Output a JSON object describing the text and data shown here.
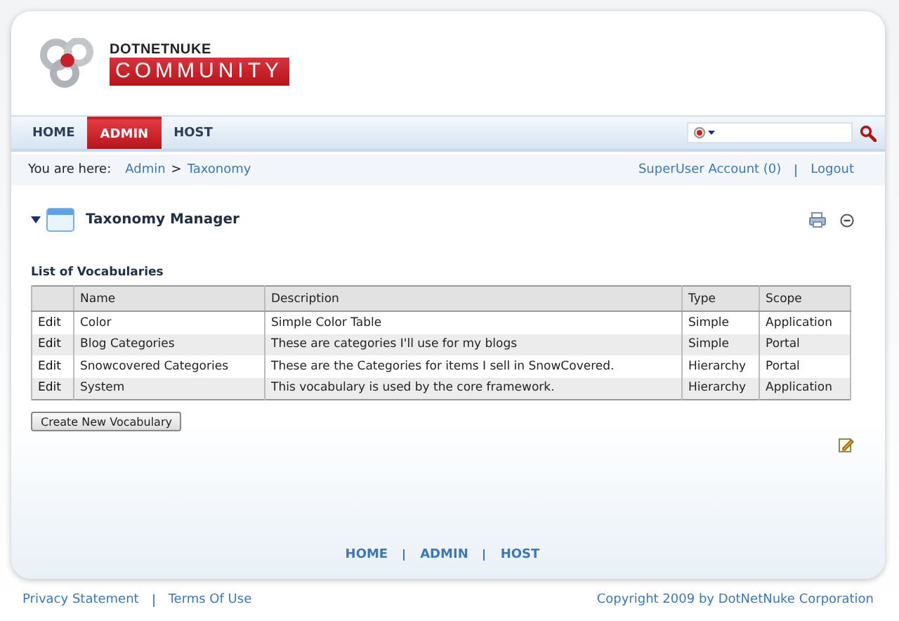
{
  "logo": {
    "top": "DOTNETNUKE",
    "bottom": "COMMUNITY"
  },
  "nav": [
    {
      "label": "HOME",
      "selected": false
    },
    {
      "label": "ADMIN",
      "selected": true
    },
    {
      "label": "HOST",
      "selected": false
    }
  ],
  "breadcrumb": {
    "prefix": "You are here:",
    "items": [
      "Admin",
      "Taxonomy"
    ],
    "separator": ">"
  },
  "user_links": [
    "SuperUser Account (0)",
    "Logout"
  ],
  "module": {
    "title": "Taxonomy Manager",
    "expanded": true
  },
  "table": {
    "caption": "List of Vocabularies",
    "columns": [
      "Name",
      "Description",
      "Type",
      "Scope"
    ],
    "rows": [
      {
        "action": "Edit",
        "cells": [
          "Color",
          "Simple Color Table",
          "Simple",
          "Application"
        ]
      },
      {
        "action": "Edit",
        "cells": [
          "Blog Categories",
          "These are categories I'll use for my blogs",
          "Simple",
          "Portal"
        ]
      },
      {
        "action": "Edit",
        "cells": [
          "Snowcovered Categories",
          "These are the Categories for items I sell in SnowCovered.",
          "Hierarchy",
          "Portal"
        ]
      },
      {
        "action": "Edit",
        "cells": [
          "System",
          "This vocabulary is used by the core framework.",
          "Hierarchy",
          "Application"
        ]
      }
    ]
  },
  "create_button": "Create New Vocabulary",
  "footer_nav": [
    "HOME",
    "ADMIN",
    "HOST"
  ],
  "footer_links": [
    "Privacy Statement",
    "Terms Of Use"
  ],
  "copyright": "Copyright 2009 by DotNetNuke Corporation"
}
